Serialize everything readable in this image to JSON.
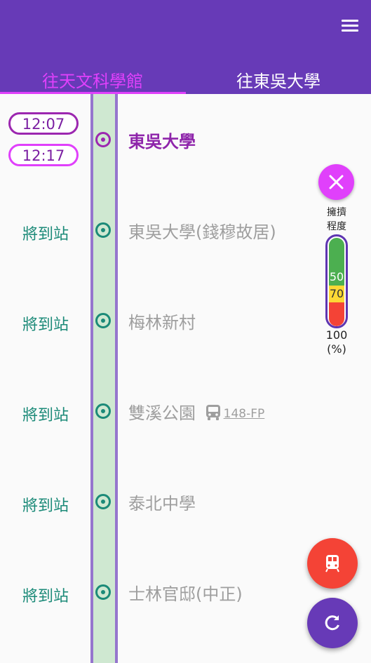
{
  "tabs": [
    {
      "label": "往天文科學館",
      "active": true
    },
    {
      "label": "往東吳大學",
      "active": false
    }
  ],
  "current_stop": {
    "times": [
      "12:07",
      "12:17"
    ],
    "name": "東吳大學"
  },
  "stops": [
    {
      "status": "將到站",
      "name": "東吳大學(錢穆故居)"
    },
    {
      "status": "將到站",
      "name": "梅林新村"
    },
    {
      "status": "將到站",
      "name": "雙溪公園",
      "transfer_route": "148-FP"
    },
    {
      "status": "將到站",
      "name": "泰北中學"
    },
    {
      "status": "將到站",
      "name": "士林官邸(中正)"
    }
  ],
  "crowd_meter": {
    "label_line1": "擁擠",
    "label_line2": "程度",
    "mark_50": "50",
    "mark_70": "70",
    "max_label": "100",
    "unit_label": "(%)"
  },
  "colors": {
    "primary": "#673ab7",
    "accent": "#e040fb",
    "arrival_text": "#1b8a78",
    "fab_red": "#f44336"
  },
  "icons": {
    "menu": "hamburger-menu-icon",
    "close": "close-icon",
    "bus": "bus-icon",
    "train": "train-icon",
    "refresh": "refresh-icon"
  }
}
